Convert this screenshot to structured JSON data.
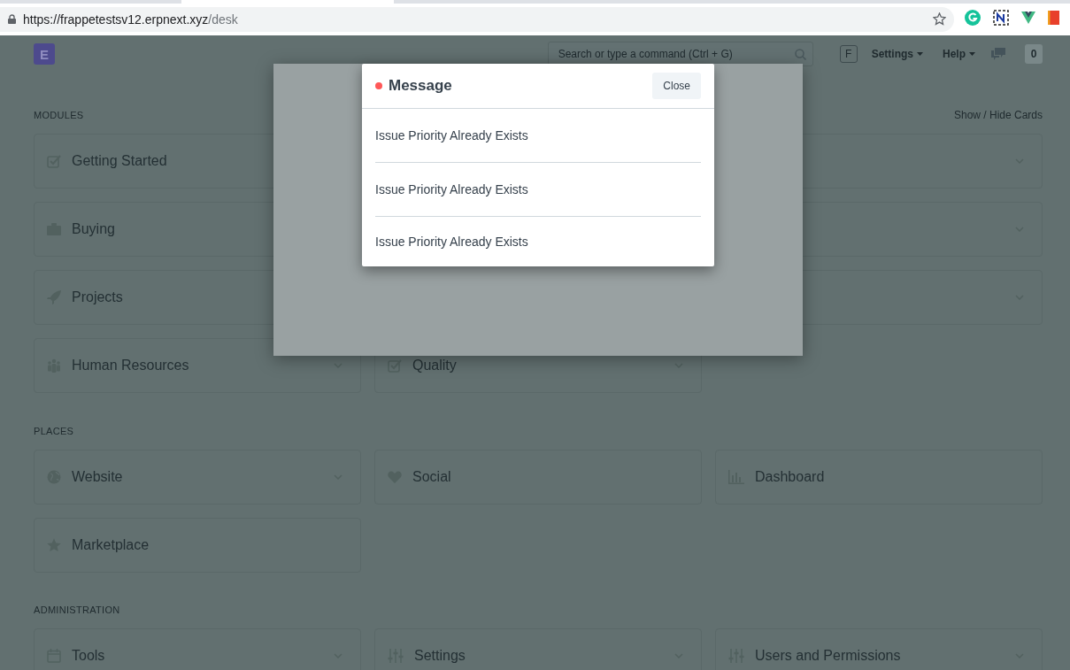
{
  "browser": {
    "url_host": "https://frappetestsv12.erpnext.xyz",
    "url_path": "/desk"
  },
  "navbar": {
    "logo": "E",
    "search": {
      "placeholder": "Search or type a command (Ctrl + G)"
    },
    "avatar": "F",
    "menus": [
      {
        "label": "Settings"
      },
      {
        "label": "Help"
      }
    ],
    "notification_count": "0"
  },
  "sections": [
    {
      "title": "MODULES",
      "action": "Show / Hide Cards",
      "cards": [
        {
          "kind": "card",
          "label": "Getting Started"
        },
        {
          "kind": "covered"
        },
        {
          "kind": "card",
          "dropdown": true
        },
        {
          "kind": "card",
          "label": "Buying"
        },
        {
          "kind": "covered"
        },
        {
          "kind": "card",
          "dropdown": true
        },
        {
          "kind": "card",
          "label": "Projects"
        },
        {
          "kind": "covered"
        },
        {
          "kind": "card",
          "dropdown": true
        },
        {
          "kind": "card",
          "label": "Human Resources",
          "dropdown": true
        },
        {
          "kind": "card",
          "label": "Quality",
          "dropdown": true
        }
      ]
    },
    {
      "title": "PLACES",
      "cards": [
        {
          "kind": "card",
          "label": "Website",
          "dropdown": true
        },
        {
          "kind": "card",
          "label": "Social",
          "dropdown": false
        },
        {
          "kind": "card",
          "label": "Dashboard",
          "dropdown": false
        },
        {
          "kind": "card",
          "label": "Marketplace",
          "dropdown": false
        }
      ]
    },
    {
      "title": "ADMINISTRATION",
      "cards": [
        {
          "kind": "card",
          "label": "Tools",
          "dropdown": true
        },
        {
          "kind": "card",
          "label": "Settings",
          "dropdown": true
        },
        {
          "kind": "card",
          "label": "Users and Permissions",
          "dropdown": true
        }
      ]
    }
  ],
  "message_dialog": {
    "title": "Message",
    "close_button": "Close",
    "messages": [
      "Issue Priority Already Exists",
      "Issue Priority Already Exists",
      "Issue Priority Already Exists"
    ]
  }
}
